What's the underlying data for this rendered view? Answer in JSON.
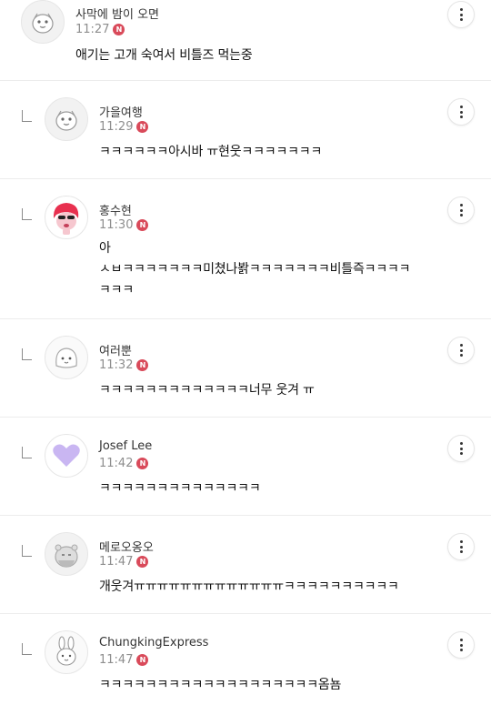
{
  "colors": {
    "badge": "#d94a5a",
    "time": "#8e8e8e",
    "divider": "#ececec"
  },
  "comments": [
    {
      "name": "사막에 밤이 오면",
      "time": "11:27",
      "badge": "N",
      "text": "애기는 고개 숙여서 비틀즈 먹는중",
      "avatar_icon": "bird-mascot-icon"
    },
    {
      "name": "가을여행",
      "time": "11:29",
      "badge": "N",
      "text": "ㅋㅋㅋㅋㅋㅋ아시바 ㅠ현웃ㅋㅋㅋㅋㅋㅋㅋ",
      "avatar_icon": "bird-mascot-icon"
    },
    {
      "name": "홍수현",
      "time": "11:30",
      "badge": "N",
      "text_lines": [
        "아",
        "ㅅㅂㅋㅋㅋㅋㅋㅋㅋ미쳤나봙ㅋㅋㅋㅋㅋㅋㅋ비틀즉ㅋㅋㅋㅋ",
        "ㅋㅋㅋ"
      ],
      "avatar_icon": "red-hair-character-icon"
    },
    {
      "name": "여러뿐",
      "time": "11:32",
      "badge": "N",
      "text": "ㅋㅋㅋㅋㅋㅋㅋㅋㅋㅋㅋㅋㅋ너무 웃겨 ㅠ",
      "avatar_icon": "round-ghost-icon"
    },
    {
      "name": "Josef Lee",
      "time": "11:42",
      "badge": "N",
      "text": "ㅋㅋㅋㅋㅋㅋㅋㅋㅋㅋㅋㅋㅋㅋ",
      "avatar_icon": "purple-heart-icon"
    },
    {
      "name": "메로오옹오",
      "time": "11:47",
      "badge": "N",
      "text": "개웃겨ㅠㅠㅠㅠㅠㅠㅠㅠㅠㅠㅠㅠㅠㅋㅋㅋㅋㅋㅋㅋㅋㅋㅋ",
      "avatar_icon": "hamster-icon"
    },
    {
      "name": "ChungkingExpress",
      "time": "11:47",
      "badge": "N",
      "text": "ㅋㅋㅋㅋㅋㅋㅋㅋㅋㅋㅋㅋㅋㅋㅋㅋㅋㅋㅋ옴뇸",
      "avatar_icon": "rabbit-icon"
    }
  ]
}
